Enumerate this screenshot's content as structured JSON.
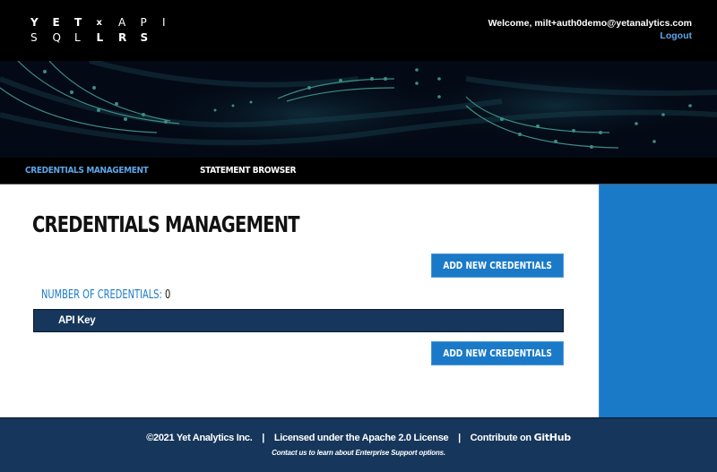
{
  "header": {
    "logo": {
      "row1": [
        "Y",
        "E",
        "T",
        "x",
        "A",
        "P",
        "I"
      ],
      "row2": [
        "S",
        "Q",
        "L",
        "L",
        "R",
        "S"
      ],
      "alt": "YET x API SQL LRS"
    },
    "welcome_text": "Welcome, milt+auth0demo@yetanalytics.com",
    "logout_label": "Logout"
  },
  "nav": {
    "tabs": [
      {
        "label": "CREDENTIALS MANAGEMENT",
        "active": true
      },
      {
        "label": "STATEMENT BROWSER",
        "active": false
      }
    ]
  },
  "main": {
    "title": "CREDENTIALS MANAGEMENT",
    "add_button_label": "ADD NEW CREDENTIALS",
    "count_label": "NUMBER OF CREDENTIALS:",
    "count_value": "0",
    "table": {
      "columns": [
        "API Key"
      ],
      "rows": []
    }
  },
  "footer": {
    "copyright": "©2021 Yet Analytics Inc.",
    "separator": "|",
    "license": "Licensed under the Apache 2.0 License",
    "contribute": "Contribute on",
    "github": "GitHub",
    "support": "Contact us to learn about Enterprise Support options."
  },
  "colors": {
    "header_bg": "#000000",
    "accent_blue": "#1b7ac8",
    "nav_active": "#5ea6e8",
    "navy": "#16365b"
  }
}
